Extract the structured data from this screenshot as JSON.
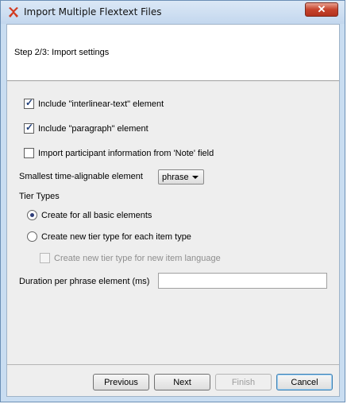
{
  "window": {
    "title": "Import Multiple Flextext Files",
    "close_label": "✕"
  },
  "header": {
    "step_title": "Step 2/3: Import settings"
  },
  "options": {
    "include_interlinear": {
      "label": "Include \"interlinear-text\" element",
      "checked": true
    },
    "include_paragraph": {
      "label": "Include \"paragraph\" element",
      "checked": true
    },
    "import_participant": {
      "label": "Import participant information from 'Note' field",
      "checked": false
    }
  },
  "smallest_element": {
    "label": "Smallest time-alignable element",
    "value": "phrase"
  },
  "tier_types": {
    "label": "Tier Types",
    "create_all_basic": {
      "label": "Create for all basic elements",
      "selected": true
    },
    "create_per_item": {
      "label": "Create new tier type for each item type",
      "selected": false
    },
    "create_per_language": {
      "label": "Create new tier type for new item language",
      "enabled": false
    }
  },
  "duration": {
    "label": "Duration per phrase element (ms)",
    "value": ""
  },
  "buttons": {
    "previous": "Previous",
    "next": "Next",
    "finish": "Finish",
    "cancel": "Cancel"
  },
  "colors": {
    "title_bar": "#c9ddf1",
    "close_button": "#c6432c",
    "default_button_border": "#3c7fb1"
  }
}
